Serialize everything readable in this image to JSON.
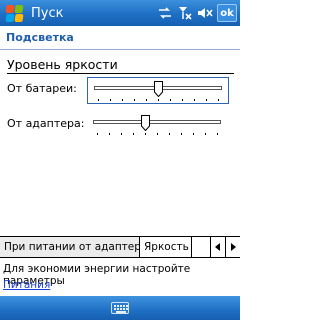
{
  "titlebar": {
    "title": "Пуск",
    "ok_label": "ok"
  },
  "section": {
    "title": "Подсветка"
  },
  "brightness": {
    "heading": "Уровень яркости",
    "battery_label": "От батареи:",
    "adapter_label": "От адаптера:",
    "battery_level": 0.5,
    "adapter_level": 0.4
  },
  "tabs": [
    {
      "label": "При питании от адаптера"
    },
    {
      "label": "Яркость"
    }
  ],
  "footer": {
    "text": "Для экономии энергии настройте параметры",
    "link": "Питания"
  },
  "icons": [
    "windows-start-icon",
    "connectivity-icon",
    "signal-off-icon",
    "volume-muted-icon",
    "keyboard-icon"
  ]
}
